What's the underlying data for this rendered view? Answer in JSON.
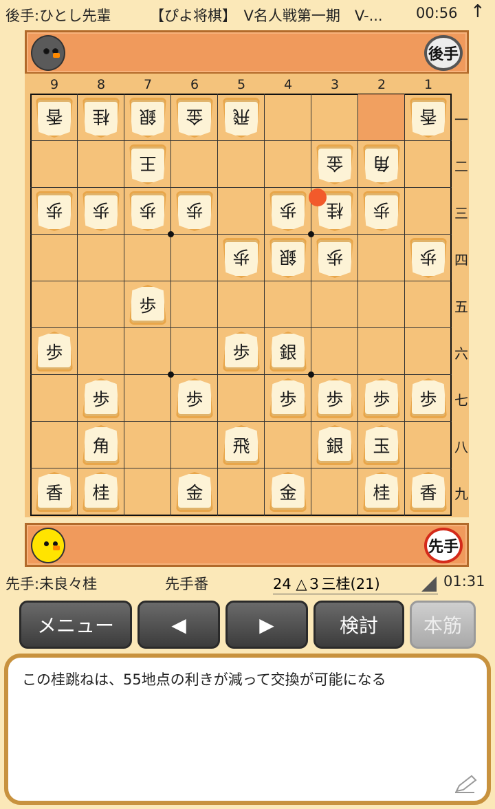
{
  "status_bar": {
    "gote_player": "後手:ひとし先輩",
    "event": "【ぴよ将棋】　V名人戦第一期　V-...",
    "time": "00:56",
    "arrow_icon": "up-arrow-icon"
  },
  "gote_hand": {
    "badge": "後手",
    "avatar": "gray-chick-avatar"
  },
  "sente_hand": {
    "badge": "先手",
    "avatar": "yellow-chick-avatar"
  },
  "board": {
    "file_labels": [
      "9",
      "8",
      "7",
      "6",
      "5",
      "4",
      "3",
      "2",
      "1"
    ],
    "rank_labels": [
      "一",
      "二",
      "三",
      "四",
      "五",
      "六",
      "七",
      "八",
      "九"
    ],
    "last_move_square": {
      "file": 2,
      "rank": 1
    },
    "marker_square": {
      "file": 3,
      "rank": 3
    },
    "pieces": [
      {
        "file": 9,
        "rank": 1,
        "char": "香",
        "side": "gote"
      },
      {
        "file": 8,
        "rank": 1,
        "char": "桂",
        "side": "gote"
      },
      {
        "file": 7,
        "rank": 1,
        "char": "銀",
        "side": "gote"
      },
      {
        "file": 6,
        "rank": 1,
        "char": "金",
        "side": "gote"
      },
      {
        "file": 5,
        "rank": 1,
        "char": "飛",
        "side": "gote"
      },
      {
        "file": 1,
        "rank": 1,
        "char": "香",
        "side": "gote"
      },
      {
        "file": 7,
        "rank": 2,
        "char": "王",
        "side": "gote"
      },
      {
        "file": 3,
        "rank": 2,
        "char": "金",
        "side": "gote"
      },
      {
        "file": 2,
        "rank": 2,
        "char": "角",
        "side": "gote"
      },
      {
        "file": 9,
        "rank": 3,
        "char": "歩",
        "side": "gote"
      },
      {
        "file": 8,
        "rank": 3,
        "char": "歩",
        "side": "gote"
      },
      {
        "file": 7,
        "rank": 3,
        "char": "歩",
        "side": "gote"
      },
      {
        "file": 6,
        "rank": 3,
        "char": "歩",
        "side": "gote"
      },
      {
        "file": 4,
        "rank": 3,
        "char": "歩",
        "side": "gote"
      },
      {
        "file": 3,
        "rank": 3,
        "char": "桂",
        "side": "gote"
      },
      {
        "file": 2,
        "rank": 3,
        "char": "歩",
        "side": "gote"
      },
      {
        "file": 5,
        "rank": 4,
        "char": "歩",
        "side": "gote"
      },
      {
        "file": 4,
        "rank": 4,
        "char": "銀",
        "side": "gote"
      },
      {
        "file": 3,
        "rank": 4,
        "char": "歩",
        "side": "gote"
      },
      {
        "file": 1,
        "rank": 4,
        "char": "歩",
        "side": "gote"
      },
      {
        "file": 7,
        "rank": 5,
        "char": "歩",
        "side": "sente"
      },
      {
        "file": 9,
        "rank": 6,
        "char": "歩",
        "side": "sente"
      },
      {
        "file": 5,
        "rank": 6,
        "char": "歩",
        "side": "sente"
      },
      {
        "file": 4,
        "rank": 6,
        "char": "銀",
        "side": "sente"
      },
      {
        "file": 8,
        "rank": 7,
        "char": "歩",
        "side": "sente"
      },
      {
        "file": 6,
        "rank": 7,
        "char": "歩",
        "side": "sente"
      },
      {
        "file": 4,
        "rank": 7,
        "char": "歩",
        "side": "sente"
      },
      {
        "file": 3,
        "rank": 7,
        "char": "歩",
        "side": "sente"
      },
      {
        "file": 2,
        "rank": 7,
        "char": "歩",
        "side": "sente"
      },
      {
        "file": 1,
        "rank": 7,
        "char": "歩",
        "side": "sente"
      },
      {
        "file": 8,
        "rank": 8,
        "char": "角",
        "side": "sente"
      },
      {
        "file": 5,
        "rank": 8,
        "char": "飛",
        "side": "sente"
      },
      {
        "file": 3,
        "rank": 8,
        "char": "銀",
        "side": "sente"
      },
      {
        "file": 2,
        "rank": 8,
        "char": "玉",
        "side": "sente"
      },
      {
        "file": 9,
        "rank": 9,
        "char": "香",
        "side": "sente"
      },
      {
        "file": 8,
        "rank": 9,
        "char": "桂",
        "side": "sente"
      },
      {
        "file": 6,
        "rank": 9,
        "char": "金",
        "side": "sente"
      },
      {
        "file": 4,
        "rank": 9,
        "char": "金",
        "side": "sente"
      },
      {
        "file": 2,
        "rank": 9,
        "char": "桂",
        "side": "sente"
      },
      {
        "file": 1,
        "rank": 9,
        "char": "香",
        "side": "sente"
      }
    ]
  },
  "info": {
    "sente_player": "先手:未良々桂",
    "turn": "先手番",
    "move": "24 △３三桂(21)",
    "clock": "01:31"
  },
  "buttons": {
    "menu": "メニュー",
    "prev": "◀",
    "next": "▶",
    "analyze": "検討",
    "mainline": "本筋"
  },
  "comment": {
    "text": "この桂跳ねは、55地点の利きが減って交換が可能になる",
    "edit_icon": "pencil-icon"
  }
}
